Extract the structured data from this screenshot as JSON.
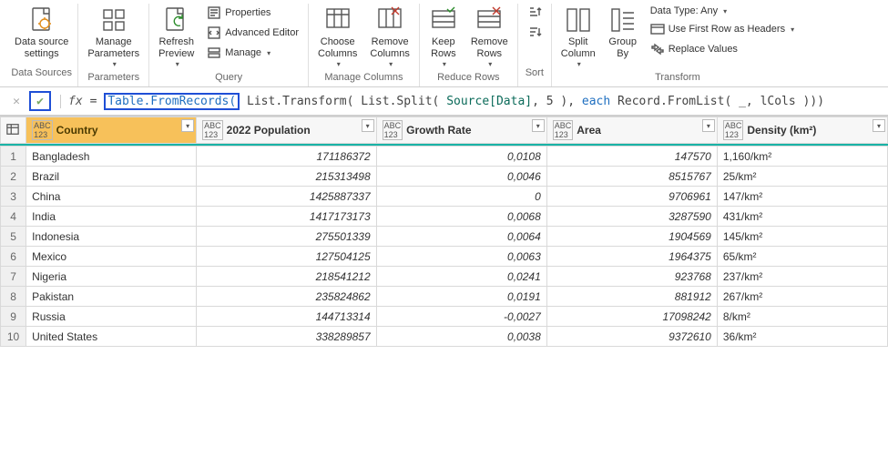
{
  "ribbon": {
    "data_source_settings": "Data source\nsettings",
    "manage_parameters": "Manage\nParameters",
    "refresh_preview": "Refresh\nPreview",
    "properties": "Properties",
    "advanced_editor": "Advanced Editor",
    "manage": "Manage",
    "choose_columns": "Choose\nColumns",
    "remove_columns": "Remove\nColumns",
    "keep_rows": "Keep\nRows",
    "remove_rows": "Remove\nRows",
    "sort_asc": "A→Z",
    "sort_desc": "Z→A",
    "split_column": "Split\nColumn",
    "group_by": "Group\nBy",
    "data_type": "Data Type: Any",
    "first_row_headers": "Use First Row as Headers",
    "replace_values": "Replace Values",
    "group_data_sources": "Data Sources",
    "group_parameters": "Parameters",
    "group_query": "Query",
    "group_manage_columns": "Manage Columns",
    "group_reduce_rows": "Reduce Rows",
    "group_sort": "Sort",
    "group_transform": "Transform"
  },
  "formula": {
    "fx": "fx",
    "prefix": "= ",
    "highlighted": "Table.FromRecords(",
    "part1": " List.Transform( List.Split( ",
    "src": "Source[Data]",
    "comma_num": ", 5 ), ",
    "each": "each",
    "part2": " Record.FromList( _, lCols )))"
  },
  "columns": [
    {
      "label": "Country"
    },
    {
      "label": "2022 Population"
    },
    {
      "label": "Growth Rate"
    },
    {
      "label": "Area"
    },
    {
      "label": "Density (km²)"
    }
  ],
  "rows": [
    {
      "n": "1",
      "country": "Bangladesh",
      "pop": "171186372",
      "growth": "0,0108",
      "area": "147570",
      "density": "1,160/km²"
    },
    {
      "n": "2",
      "country": "Brazil",
      "pop": "215313498",
      "growth": "0,0046",
      "area": "8515767",
      "density": "25/km²"
    },
    {
      "n": "3",
      "country": "China",
      "pop": "1425887337",
      "growth": "0",
      "area": "9706961",
      "density": "147/km²"
    },
    {
      "n": "4",
      "country": "India",
      "pop": "1417173173",
      "growth": "0,0068",
      "area": "3287590",
      "density": "431/km²"
    },
    {
      "n": "5",
      "country": "Indonesia",
      "pop": "275501339",
      "growth": "0,0064",
      "area": "1904569",
      "density": "145/km²"
    },
    {
      "n": "6",
      "country": "Mexico",
      "pop": "127504125",
      "growth": "0,0063",
      "area": "1964375",
      "density": "65/km²"
    },
    {
      "n": "7",
      "country": "Nigeria",
      "pop": "218541212",
      "growth": "0,0241",
      "area": "923768",
      "density": "237/km²"
    },
    {
      "n": "8",
      "country": "Pakistan",
      "pop": "235824862",
      "growth": "0,0191",
      "area": "881912",
      "density": "267/km²"
    },
    {
      "n": "9",
      "country": "Russia",
      "pop": "144713314",
      "growth": "-0,0027",
      "area": "17098242",
      "density": "8/km²"
    },
    {
      "n": "10",
      "country": "United States",
      "pop": "338289857",
      "growth": "0,0038",
      "area": "9372610",
      "density": "36/km²"
    }
  ],
  "type_badge": "ABC\n123"
}
